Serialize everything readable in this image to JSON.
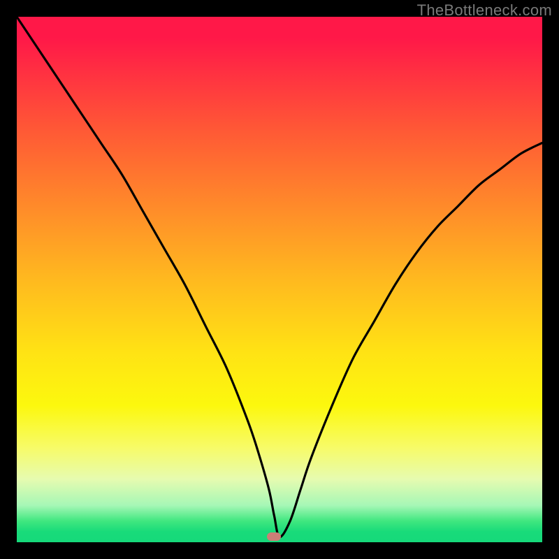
{
  "watermark": "TheBottleneck.com",
  "colors": {
    "frame": "#000000",
    "curve": "#000000",
    "pill": "#cc7f77"
  },
  "chart_data": {
    "type": "line",
    "title": "",
    "xlabel": "",
    "ylabel": "",
    "xlim": [
      0,
      100
    ],
    "ylim": [
      0,
      100
    ],
    "series": [
      {
        "name": "bottleneck-curve",
        "x": [
          0,
          4,
          8,
          12,
          16,
          20,
          24,
          28,
          32,
          36,
          40,
          44,
          46,
          48,
          49,
          50,
          52,
          54,
          56,
          60,
          64,
          68,
          72,
          76,
          80,
          84,
          88,
          92,
          96,
          100
        ],
        "y": [
          100,
          94,
          88,
          82,
          76,
          70,
          63,
          56,
          49,
          41,
          33,
          23,
          17,
          10,
          5,
          1,
          4,
          10,
          16,
          26,
          35,
          42,
          49,
          55,
          60,
          64,
          68,
          71,
          74,
          76
        ]
      }
    ],
    "marker": {
      "x": 49,
      "y": 1,
      "shape": "pill"
    },
    "gradient_stops": [
      {
        "pos": 0.0,
        "color": "#ff1848"
      },
      {
        "pos": 0.5,
        "color": "#ffe314"
      },
      {
        "pos": 0.98,
        "color": "#16d97a"
      }
    ]
  }
}
